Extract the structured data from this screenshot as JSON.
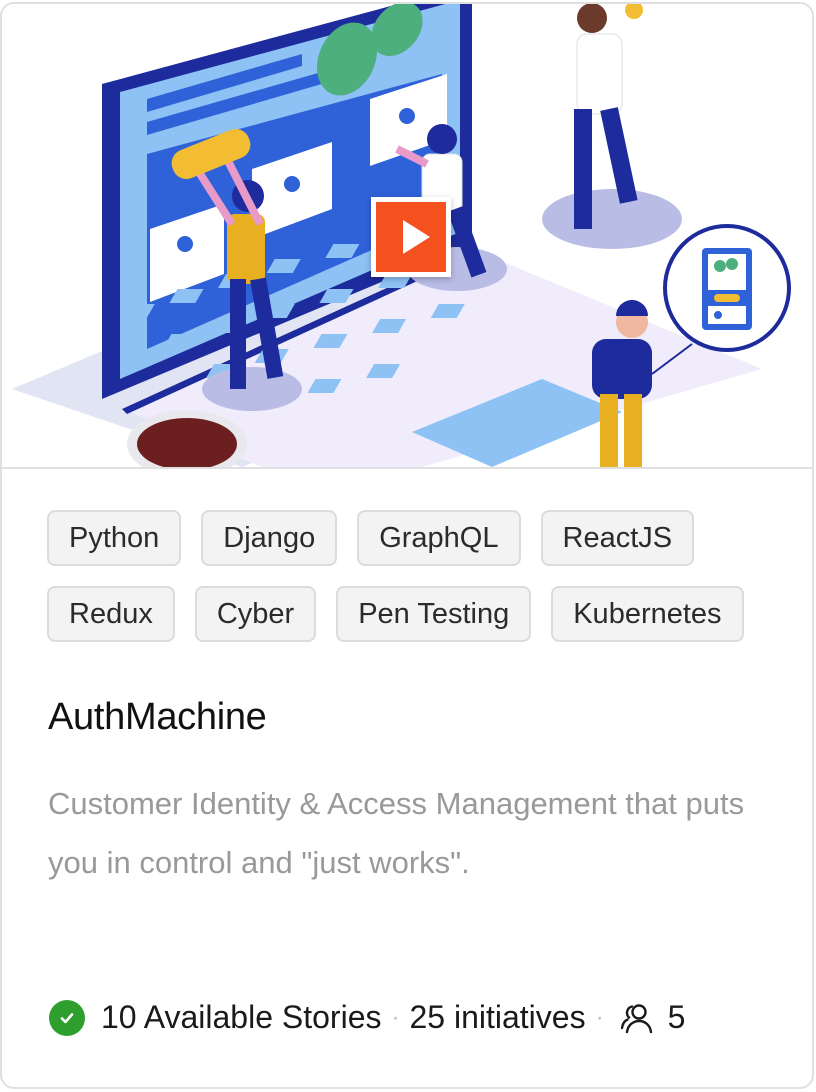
{
  "hero": {
    "play_icon": "play-icon",
    "accent_color": "#f4511e"
  },
  "tags": {
    "row1": [
      "Python",
      "Django",
      "GraphQL",
      "ReactJS"
    ],
    "row2": [
      "Redux",
      "Cyber",
      "Pen Testing",
      "Kubernetes"
    ]
  },
  "project": {
    "title": "AuthMachine",
    "description": "Customer Identity & Access Management that puts you in control and \"just works\"."
  },
  "footer": {
    "status_icon": "check-circle-icon",
    "status_color": "#2e9e2e",
    "stories_label": "10 Available Stories",
    "separator": "·",
    "initiatives_label": "25 initiatives",
    "members_icon": "people-icon",
    "members_count": "5"
  }
}
